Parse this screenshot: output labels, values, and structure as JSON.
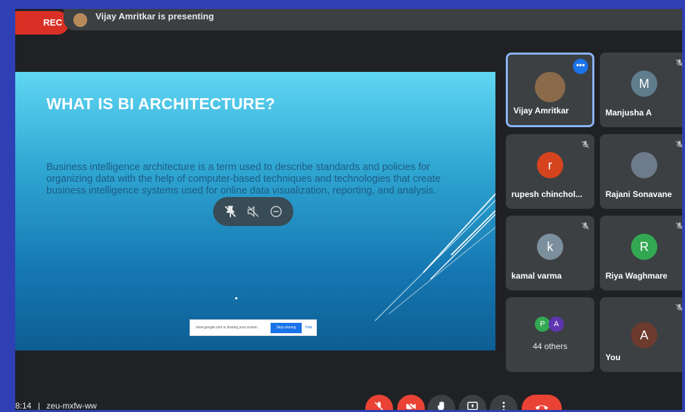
{
  "top_bar": {
    "rec_label": "REC",
    "presenting_text": "Vijay Amritkar is presenting"
  },
  "slide": {
    "title": "WHAT IS BI ARCHITECTURE?",
    "body": "Business intelligence architecture is a term used to describe standards and policies for organizing data with the help of computer-based techniques and technologies that create business intelligence systems used for online data visualization, reporting, and analysis.",
    "share_banner": {
      "message": "meet.google.com is sharing your screen.",
      "stop_label": "Stop sharing",
      "hide_label": "Hide"
    }
  },
  "participants": [
    {
      "name": "Vijay Amritkar",
      "initial": "",
      "avatar_color": "#8a6a4a",
      "active": true
    },
    {
      "name": "Manjusha A",
      "initial": "M",
      "avatar_color": "#5f7d8c"
    },
    {
      "name": "rupesh chinchol...",
      "initial": "r",
      "avatar_color": "#d5431f"
    },
    {
      "name": "Rajani Sonavane",
      "initial": "",
      "avatar_color": "#6d7b8a"
    },
    {
      "name": "kamal varma",
      "initial": "k",
      "avatar_color": "#7b8f9c"
    },
    {
      "name": "Riya Waghmare",
      "initial": "R",
      "avatar_color": "#33a852"
    },
    {
      "name": "44 others",
      "initial_p": "P",
      "initial_a": "A",
      "color_p": "#33a852",
      "color_a": "#5e35b1"
    },
    {
      "name": "You",
      "initial": "A",
      "avatar_color": "#6d3b2e"
    }
  ],
  "bottom": {
    "time": "8:14",
    "separator": "|",
    "meeting_code": "zeu-mxfw-ww"
  },
  "colors": {
    "end_call": "#ea4335",
    "accent": "#8ab4f8"
  }
}
